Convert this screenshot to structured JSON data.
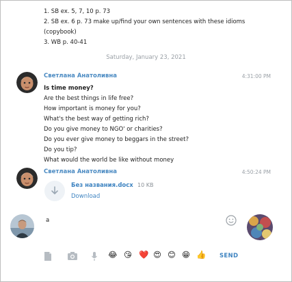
{
  "previous_message": {
    "lines": [
      "1. SB ex. 5, 7, 10 p. 73",
      "2. SB ex. 6 p. 73 make up/find your own sentences with these idioms (copybook)",
      "3. WB p. 40-41"
    ]
  },
  "date_separator": "Saturday, January 23, 2021",
  "messages": [
    {
      "sender": "Светлана Анатоливна",
      "time": "4:31:00 PM",
      "title": "Is time money?",
      "lines": [
        "Are the best things in life free?",
        "How important is money for you?",
        "What's the best way of getting rich?",
        "Do you give money to NGO' or charities?",
        "Do you ever give money to beggars in the street?",
        "Do you tip?",
        "What would the world be like without money"
      ]
    },
    {
      "sender": "Светлана Анатоливна",
      "time": "4:50:24 PM",
      "file": {
        "name": "Без названия.docx",
        "size": "10 KB",
        "action": "Download",
        "icon": "download-arrow-icon"
      }
    }
  ],
  "composer": {
    "value": "a",
    "emoji_button_icon": "smiley-outline-icon",
    "toolbar_icons": [
      "attach-file-icon",
      "camera-icon",
      "microphone-icon"
    ],
    "quick_emojis": [
      "😂",
      "😘",
      "❤️",
      "😍",
      "😊",
      "😁",
      "👍"
    ],
    "send_label": "SEND"
  },
  "colors": {
    "accent": "#3f84c1",
    "sender": "#4a8ac2",
    "muted": "#9aa0a6"
  }
}
